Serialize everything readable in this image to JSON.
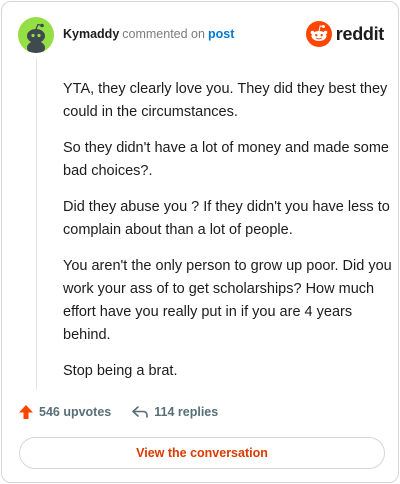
{
  "header": {
    "username": "Kymaddy",
    "action": "commented on",
    "post_link": "post",
    "brand": "reddit"
  },
  "comment": {
    "paragraphs": [
      "YTA, they clearly love you. They did they best they could in the circumstances.",
      "So they didn't have a lot of money and made some bad choices?.",
      "Did they abuse you ? If they didn't you have less to complain about than a lot of people.",
      "You aren't the only person to grow up poor. Did you work your ass of to get scholarships? How much effort have you really put in if you are 4 years behind.",
      "Stop being a brat."
    ]
  },
  "footer": {
    "upvotes": "546 upvotes",
    "replies": "114 replies"
  },
  "cta": {
    "label": "View the conversation"
  },
  "icons": {
    "avatar": "snoo-avatar-icon",
    "logo": "reddit-snoo-icon",
    "upvote": "upvote-arrow-icon",
    "reply": "reply-arrow-icon"
  },
  "colors": {
    "avatar_bg": "#94e044",
    "brand_orange": "#ff4500",
    "link_blue": "#0079d3",
    "cta_text": "#d93a00",
    "muted": "#576f76"
  }
}
